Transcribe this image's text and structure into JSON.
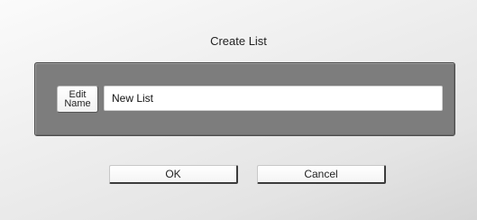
{
  "dialog": {
    "title": "Create List",
    "edit_name_button": {
      "line1": "Edit",
      "line2": "Name"
    },
    "name_field_value": "New List",
    "ok_label": "OK",
    "cancel_label": "Cancel"
  },
  "colors": {
    "panel": "#7d7d7d",
    "background": "#ececec",
    "field": "#ffffff"
  }
}
